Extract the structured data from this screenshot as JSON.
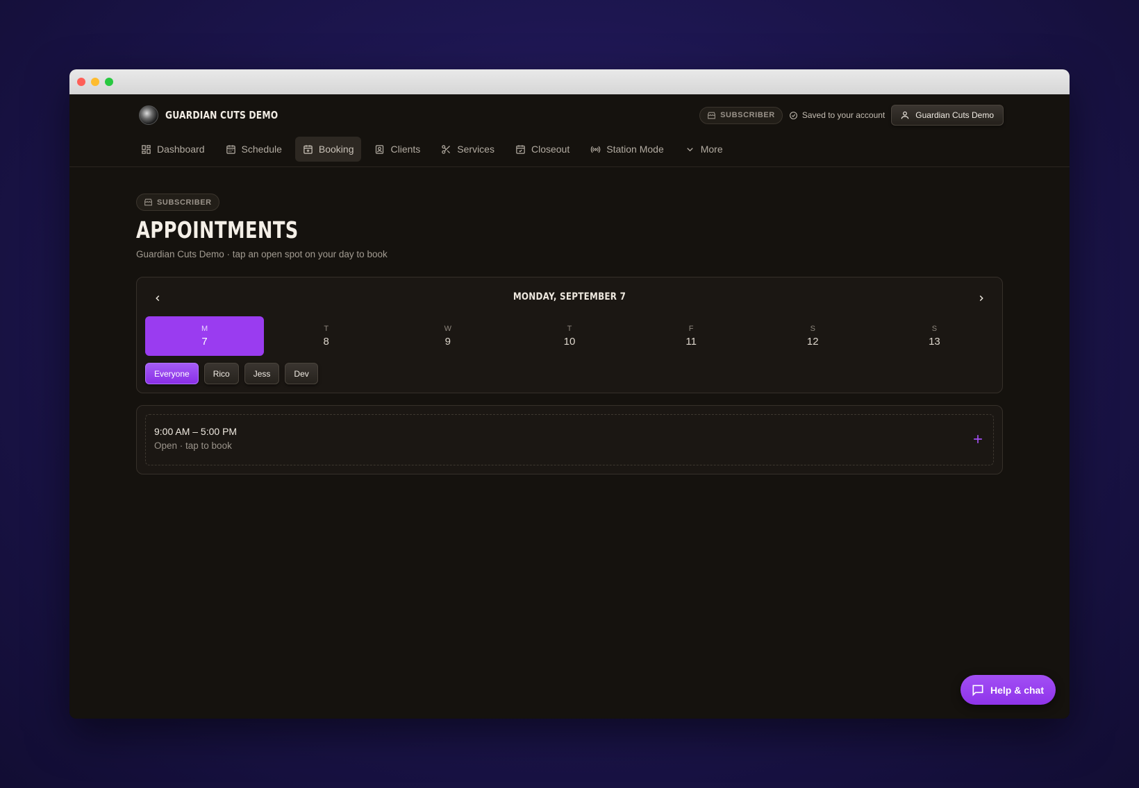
{
  "window": {
    "controls": [
      "close",
      "minimize",
      "maximize"
    ]
  },
  "header": {
    "brand_name": "GUARDIAN CUTS DEMO",
    "plan_badge": "SUBSCRIBER",
    "saved_status": "Saved to your account",
    "account_name": "Guardian Cuts Demo"
  },
  "nav": {
    "items": [
      {
        "label": "Dashboard",
        "icon": "dashboard-grid-icon",
        "active": false
      },
      {
        "label": "Schedule",
        "icon": "calendar-icon",
        "active": false
      },
      {
        "label": "Booking",
        "icon": "calendar-plus-icon",
        "active": true
      },
      {
        "label": "Clients",
        "icon": "contact-card-icon",
        "active": false
      },
      {
        "label": "Services",
        "icon": "scissors-icon",
        "active": false
      },
      {
        "label": "Closeout",
        "icon": "calendar-check-icon",
        "active": false
      },
      {
        "label": "Station Mode",
        "icon": "broadcast-icon",
        "active": false
      },
      {
        "label": "More",
        "icon": "chevron-down-icon",
        "active": false
      }
    ]
  },
  "page": {
    "badge": "SUBSCRIBER",
    "title": "APPOINTMENTS",
    "subtitle": "Guardian Cuts Demo · tap an open spot on your day to book"
  },
  "calendar": {
    "selected_date_label": "MONDAY, SEPTEMBER 7",
    "days": [
      {
        "letter": "M",
        "number": "7",
        "selected": true
      },
      {
        "letter": "T",
        "number": "8",
        "selected": false
      },
      {
        "letter": "W",
        "number": "9",
        "selected": false
      },
      {
        "letter": "T",
        "number": "10",
        "selected": false
      },
      {
        "letter": "F",
        "number": "11",
        "selected": false
      },
      {
        "letter": "S",
        "number": "12",
        "selected": false
      },
      {
        "letter": "S",
        "number": "13",
        "selected": false
      }
    ],
    "staff_filters": [
      {
        "label": "Everyone",
        "selected": true
      },
      {
        "label": "Rico",
        "selected": false
      },
      {
        "label": "Jess",
        "selected": false
      },
      {
        "label": "Dev",
        "selected": false
      }
    ]
  },
  "slots": [
    {
      "time": "9:00 AM – 5:00 PM",
      "status": "Open · tap to book"
    }
  ],
  "help_button": {
    "label": "Help & chat"
  },
  "colors": {
    "accent": "#9a3cf0",
    "background": "#15120e",
    "card": "#1b1713",
    "text": "#f1ece4"
  }
}
